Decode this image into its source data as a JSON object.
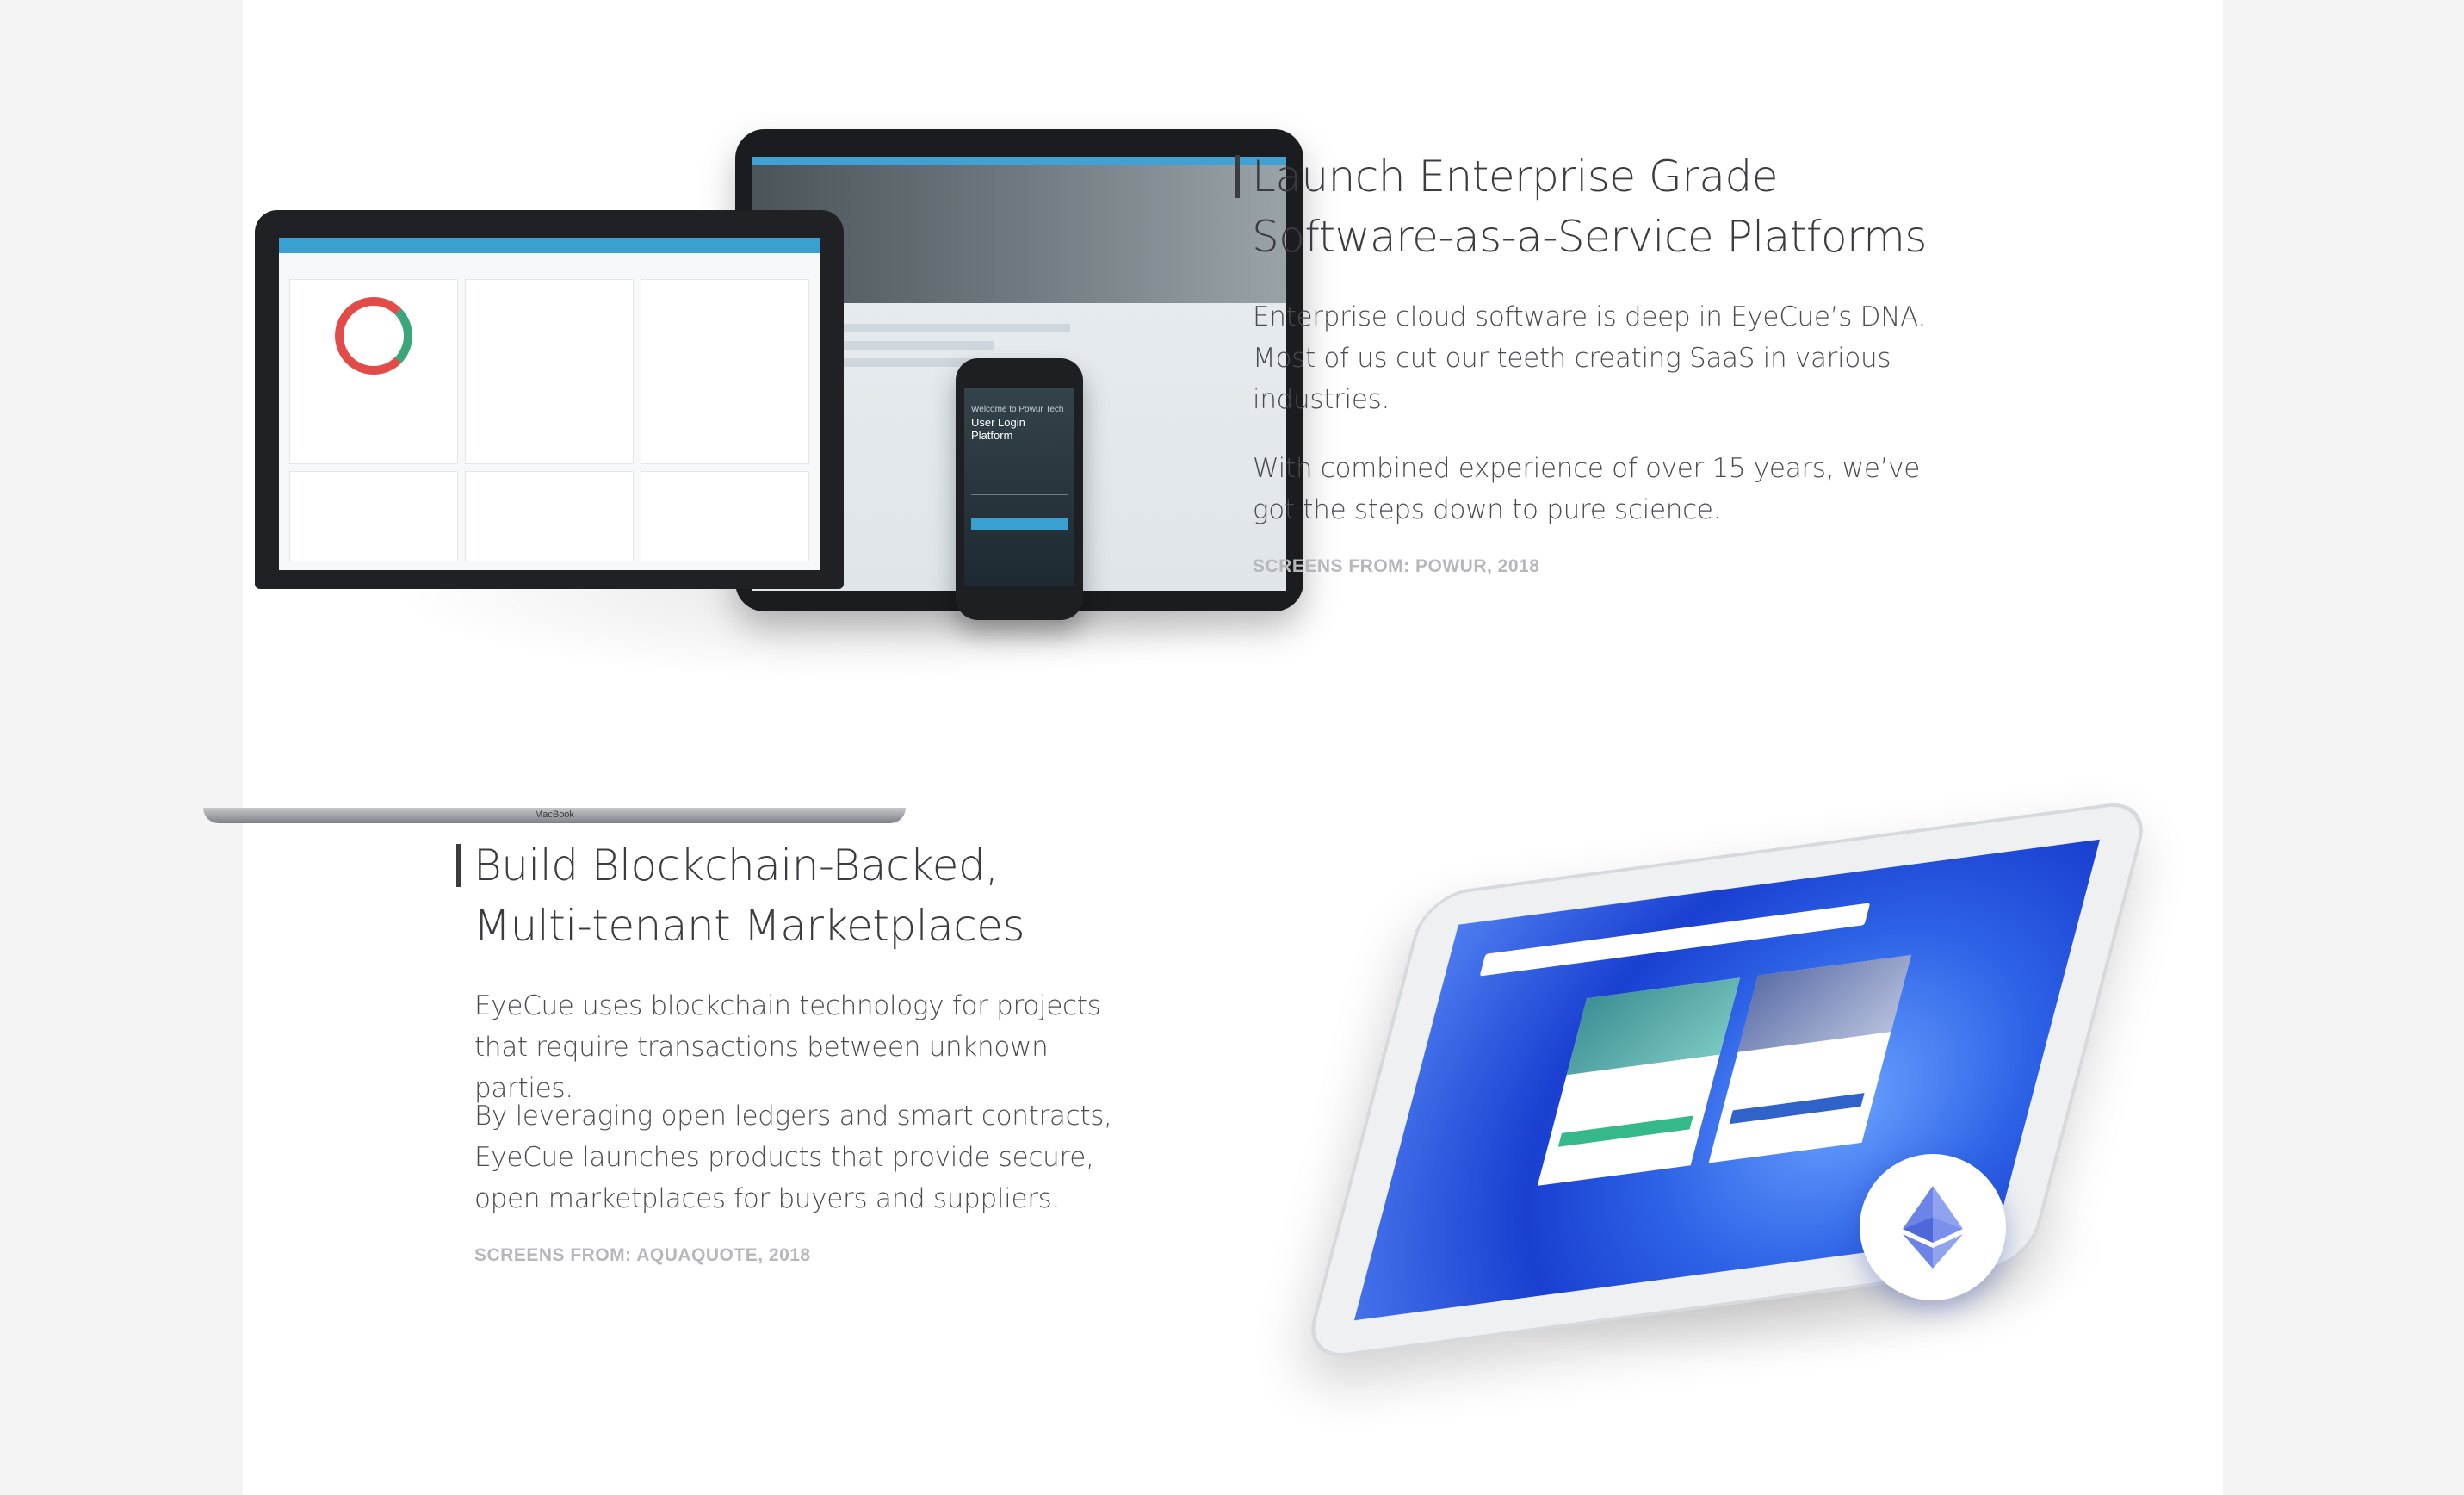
{
  "section1": {
    "heading_line1": "Launch Enterprise Grade",
    "heading_line2": "Software-as-a-Service Platforms",
    "para1": "Enterprise cloud software is deep in EyeCue’s DNA. Most of us cut our teeth creating SaaS in various industries.",
    "para2": "With combined experience of over 15 years, we’ve got the steps down to pure science.",
    "credit": "SCREENS FROM: POWUR, 2018",
    "devices": {
      "laptop_brand": "MacBook",
      "phone_label1": "Welcome to Powur Tech",
      "phone_label2": "User Login Platform"
    }
  },
  "section2": {
    "heading_line1": "Build Blockchain-Backed,",
    "heading_line2": "Multi-tenant Marketplaces",
    "para1": "EyeCue uses blockchain technology for projects that require transactions between unknown parties.",
    "para2": "By leveraging open ledgers and smart contracts, EyeCue launches products that provide secure, open marketplaces for buyers and suppliers.",
    "credit": "SCREENS FROM: AQUAQUOTE, 2018",
    "badge_icon": "ethereum-icon"
  }
}
